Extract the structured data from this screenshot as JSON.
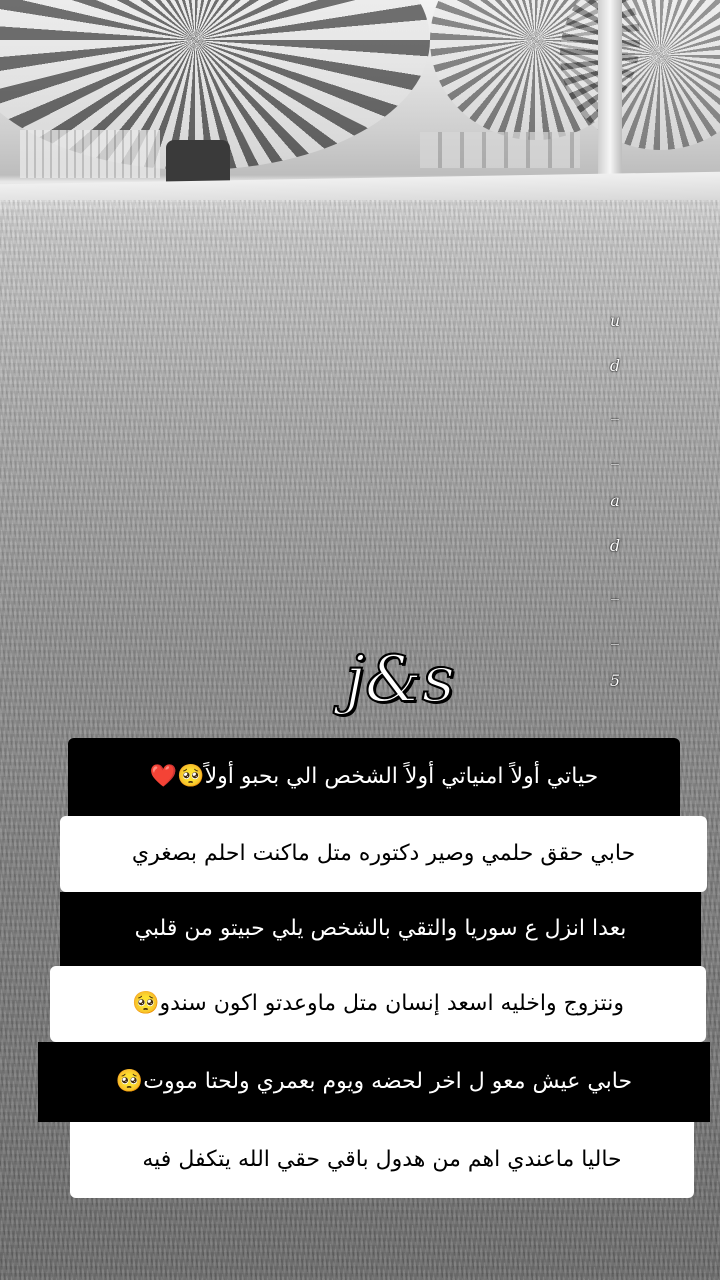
{
  "story": {
    "vertical_handle": [
      "u",
      "d",
      "_",
      "_",
      "a",
      "d",
      "_",
      "_",
      "5"
    ],
    "logo_text": "j&s",
    "captions": [
      "حياتي أولاً امنياتي أولاً الشخص الي بحبو أولاً🥺❤️",
      "حابي حقق حلمي وصير دكتوره متل ماكنت احلم بصغري",
      "بعدا انزل ع سوريا والتقي بالشخص يلي حبيتو من قلبي",
      "ونتزوج واخليه اسعد إنسان متل ماوعدتو اكون سندو🥺",
      "حابي عيش معو ل اخر لحضه ويوم بعمري ولحتا مووت🥺",
      "حاليا ماعندي اهم من هدول باقي حقي الله يتكفل فيه"
    ]
  }
}
